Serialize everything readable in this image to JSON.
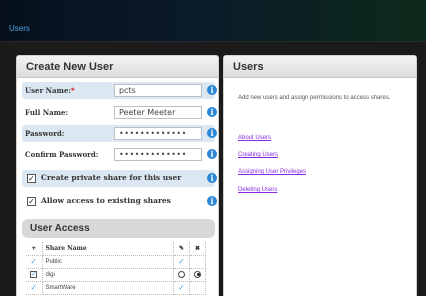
{
  "header": {
    "title": "Users"
  },
  "create_user": {
    "title": "Create New User",
    "fields": {
      "user_name": {
        "label": "User Name:",
        "required": "*",
        "value": "pcts"
      },
      "full_name": {
        "label": "Full Name:",
        "value": "Peeter Meeter"
      },
      "password": {
        "label": "Password:",
        "value": "•••••••••••••"
      },
      "confirm_password": {
        "label": "Confirm Password:",
        "value": "•••••••••••••"
      }
    },
    "options": {
      "create_private_share": {
        "label": "Create private share for this user",
        "checked": true
      },
      "allow_existing_shares": {
        "label": "Allow access to existing shares",
        "checked": true
      }
    },
    "info_icon": "i"
  },
  "user_access": {
    "title": "User Access",
    "columns": {
      "add": "+",
      "name": "Share Name",
      "edit": "✎",
      "deny": "✖"
    },
    "rows": [
      {
        "selected": "✓",
        "name": "Public",
        "edit": "✓",
        "deny": "",
        "mode": "check"
      },
      {
        "selected": "✓",
        "name": "digi",
        "edit": "",
        "deny": "",
        "mode": "radio"
      },
      {
        "selected": "✓",
        "name": "SmartWare",
        "edit": "✓",
        "deny": "",
        "mode": "check"
      }
    ]
  },
  "users_help": {
    "title": "Users",
    "description": "Add new users and assign permissions to access shares.",
    "links": [
      "About Users",
      "Creating Users",
      "Assigning User Privileges",
      "Deleting Users"
    ]
  },
  "colors": {
    "accent": "#4fa3e0",
    "info_icon": "#2a86d6",
    "link": "#8a2be2",
    "required": "#cc0000",
    "deny": "#c0392b",
    "highlight_row": "#dbe8f3"
  },
  "icons": {
    "info": "info-icon",
    "check": "check-icon",
    "pencil": "pencil-icon",
    "deny": "x-icon",
    "add": "plus-icon"
  }
}
